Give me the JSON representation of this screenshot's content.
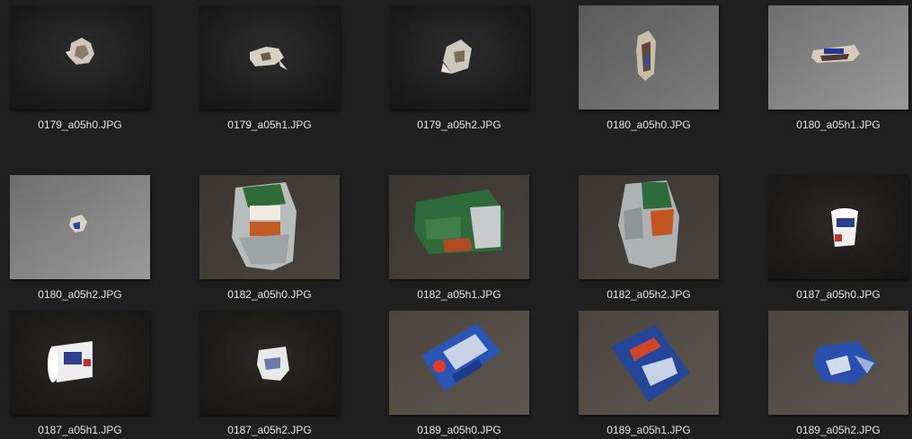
{
  "window": {
    "background": "#1f1f1f"
  },
  "files": [
    {
      "name": "0179_a05h0.JPG",
      "bg": "dark-black",
      "object": "foil-crumpled-small"
    },
    {
      "name": "0179_a05h1.JPG",
      "bg": "dark-black",
      "object": "foil-crumpled-small"
    },
    {
      "name": "0179_a05h2.JPG",
      "bg": "dark-black",
      "object": "foil-crumpled-small"
    },
    {
      "name": "0180_a05h0.JPG",
      "bg": "grey-light",
      "object": "wrapper-vertical"
    },
    {
      "name": "0180_a05h1.JPG",
      "bg": "grey-light",
      "object": "wrapper-horizontal"
    },
    {
      "name": "0180_a05h2.JPG",
      "bg": "grey-light",
      "object": "wrapper-crumpled-blue"
    },
    {
      "name": "0182_a05h0.JPG",
      "bg": "dark-brown",
      "object": "green-bag-tiradell"
    },
    {
      "name": "0182_a05h1.JPG",
      "bg": "dark-brown",
      "object": "green-bag-flat"
    },
    {
      "name": "0182_a05h2.JPG",
      "bg": "dark-brown",
      "object": "green-bag-crumpled"
    },
    {
      "name": "0187_a05h0.JPG",
      "bg": "dark-black",
      "object": "yogurt-cup-white"
    },
    {
      "name": "0187_a05h1.JPG",
      "bg": "dark-black",
      "object": "yogurt-cup-side"
    },
    {
      "name": "0187_a05h2.JPG",
      "bg": "dark-black",
      "object": "yogurt-cup-crushed"
    },
    {
      "name": "0189_a05h0.JPG",
      "bg": "dark-warm",
      "object": "blue-bag-flat"
    },
    {
      "name": "0189_a05h1.JPG",
      "bg": "dark-warm",
      "object": "blue-bag-crumpled"
    },
    {
      "name": "0189_a05h2.JPG",
      "bg": "dark-warm",
      "object": "blue-bag-crushed"
    }
  ]
}
